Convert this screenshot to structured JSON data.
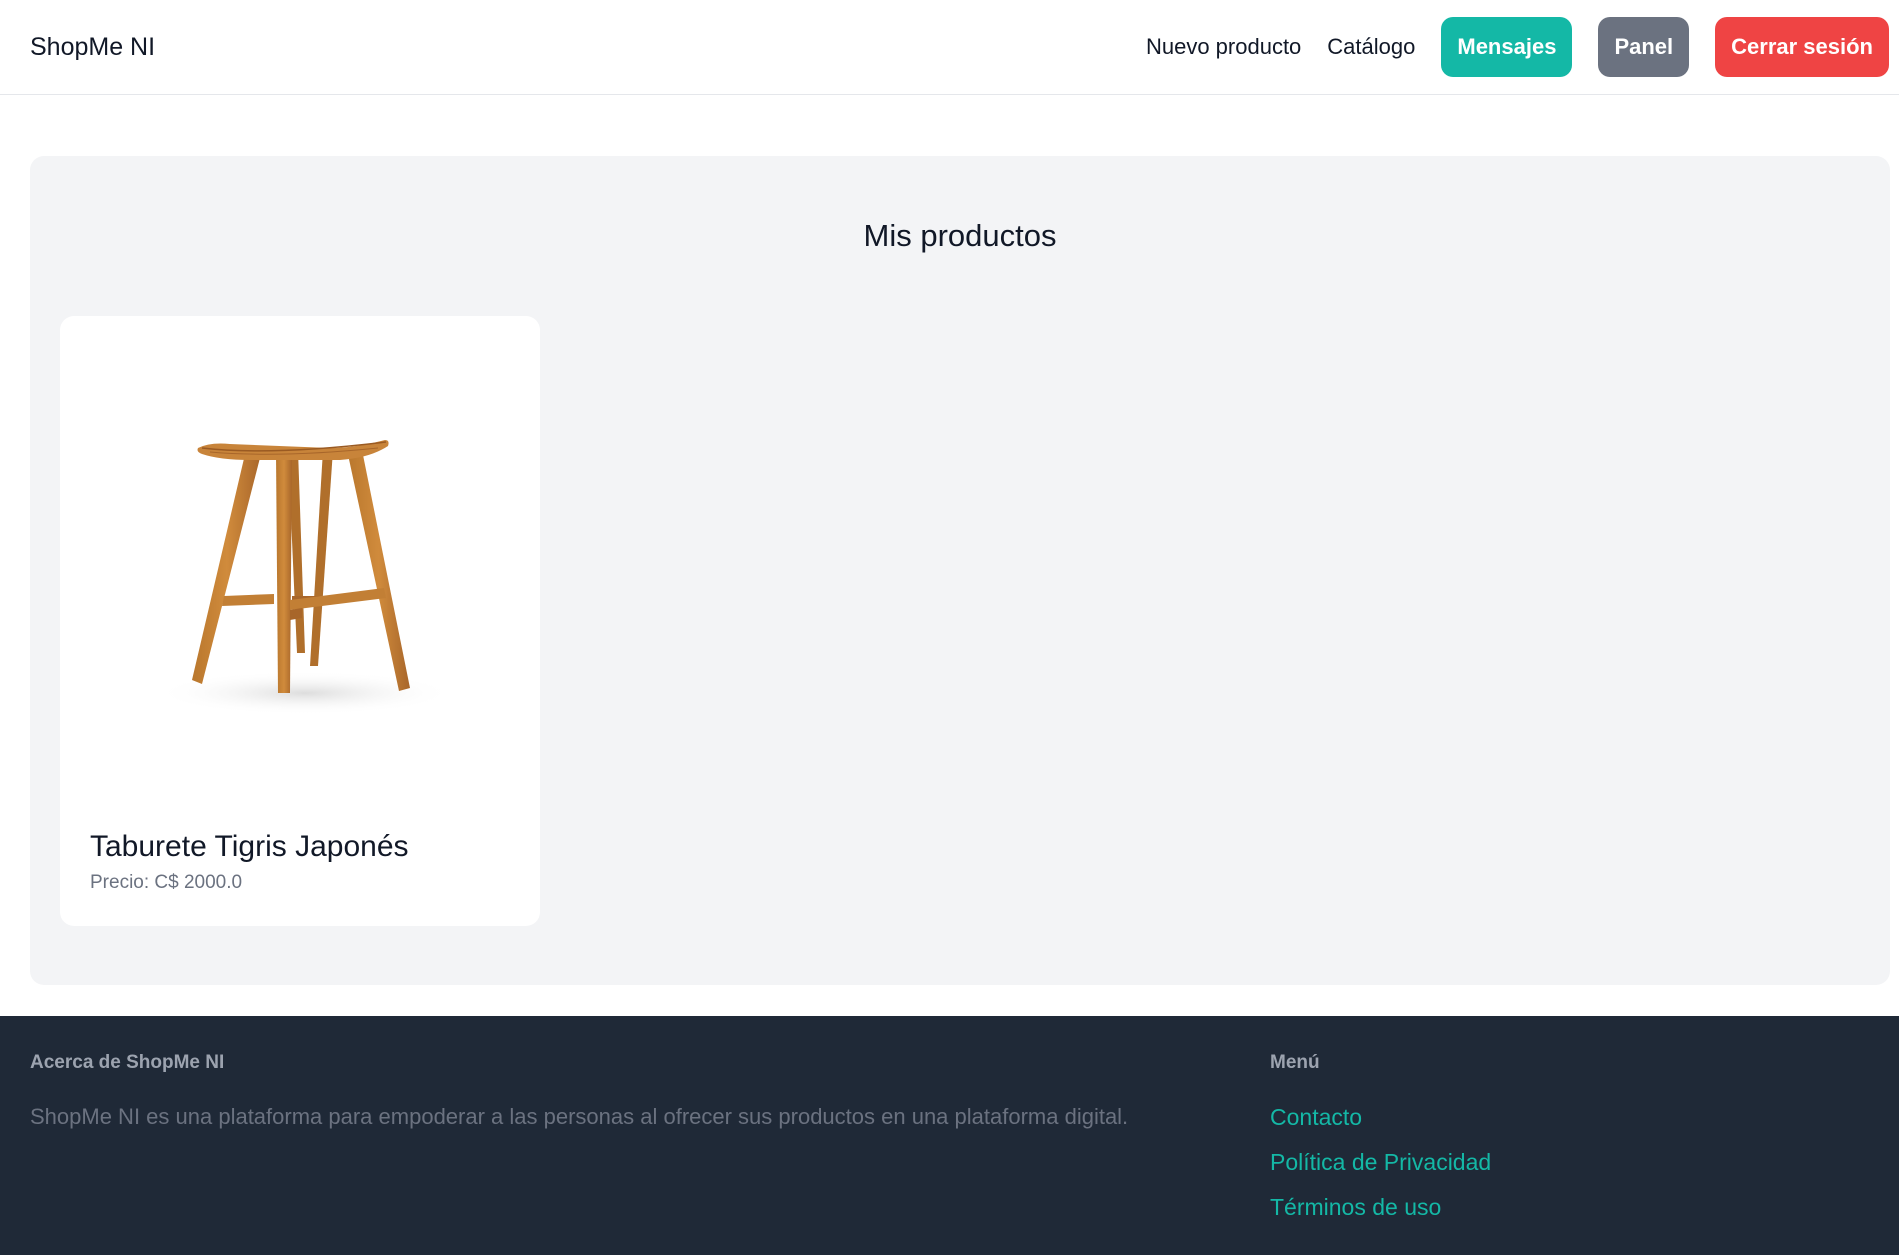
{
  "header": {
    "brand": "ShopMe NI",
    "nav": {
      "new_product": "Nuevo producto",
      "catalog": "Catálogo",
      "messages": "Mensajes",
      "panel": "Panel",
      "logout": "Cerrar sesión"
    }
  },
  "main": {
    "title": "Mis productos",
    "products": [
      {
        "name": "Taburete Tigris Japonés",
        "price": "Precio: C$ 2000.0",
        "image": "wooden-stool"
      }
    ]
  },
  "footer": {
    "about_heading": "Acerca de ShopMe NI",
    "about_text": "ShopMe NI es una plataforma para empoderar a las personas al ofrecer sus productos en una plataforma digital.",
    "menu_heading": "Menú",
    "links": [
      {
        "label": "Contacto"
      },
      {
        "label": "Política de Privacidad"
      },
      {
        "label": "Términos de uso"
      }
    ]
  },
  "colors": {
    "accent_teal": "#14b8a6",
    "panel_gray": "#6b7280",
    "danger_red": "#ef4444",
    "footer_bg": "#1f2937",
    "panel_bg": "#f3f4f6"
  }
}
